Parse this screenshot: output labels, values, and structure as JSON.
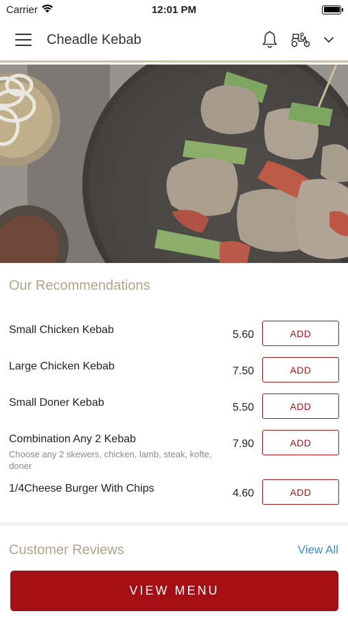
{
  "status_bar": {
    "carrier": "Carrier",
    "time": "12:01 PM"
  },
  "header": {
    "title": "Cheadle Kebab",
    "icons": [
      "menu-icon",
      "bell-icon",
      "scooter-icon",
      "chevron-down-icon"
    ]
  },
  "recommendations": {
    "title": "Our Recommendations",
    "items": [
      {
        "name": "Small Chicken Kebab",
        "description": "",
        "price": "5.60",
        "button": "ADD"
      },
      {
        "name": "Large Chicken Kebab",
        "description": "",
        "price": "7.50",
        "button": "ADD"
      },
      {
        "name": "Small Doner Kebab",
        "description": "",
        "price": "5.50",
        "button": "ADD"
      },
      {
        "name": "Combination Any 2 Kebab",
        "description": "Choose any 2 skewers, chicken, lamb, steak, kofte, doner",
        "price": "7.90",
        "button": "ADD"
      },
      {
        "name": "1/4Cheese Burger With Chips",
        "description": "",
        "price": "4.60",
        "button": "ADD"
      }
    ]
  },
  "reviews": {
    "title": "Customer Reviews",
    "view_all": "View All"
  },
  "footer": {
    "view_menu": "VIEW MENU"
  },
  "colors": {
    "brand_red": "#a30f14",
    "accent_gold": "#b3a58a",
    "link_blue": "#3a8fc4"
  }
}
